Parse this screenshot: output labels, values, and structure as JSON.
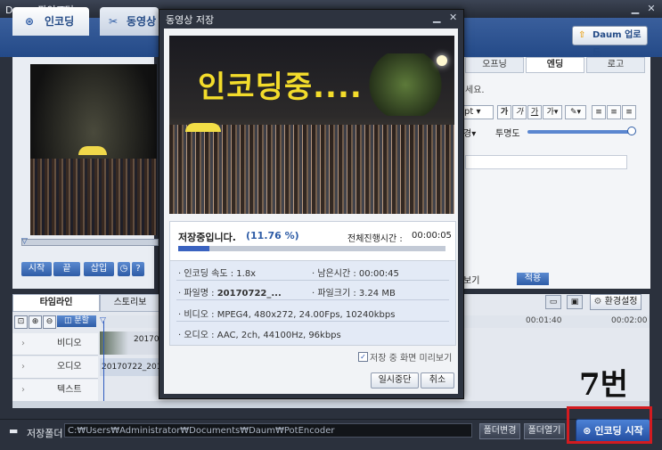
{
  "app": {
    "title": "Daum 팟인코더",
    "tabs": [
      {
        "label": "인코딩"
      },
      {
        "label": "동영상"
      }
    ],
    "upgrade_label": "Daum 업로드"
  },
  "editor": {
    "right_tabs": [
      "오프닝",
      "엔딩",
      "로고"
    ],
    "hint_fragment": "세요.",
    "font_size": "pt",
    "format_buttons": [
      "가",
      "가",
      "가",
      "가"
    ],
    "opacity_label": "투명도",
    "apply_label": "적용",
    "tail_label": "보기",
    "env_label": "환경설정"
  },
  "player": {
    "controls": [
      "시작",
      "끝",
      "삽입",
      "?"
    ]
  },
  "timeline": {
    "tabs": [
      "타임라인",
      "스토리보"
    ],
    "split_label": "분할",
    "ruler": [
      "00:01:40",
      "00:02:00"
    ],
    "tracks": [
      "비디오",
      "오디오",
      "텍스트"
    ],
    "video_clip": "20170",
    "audio_clip": "20170722_201302"
  },
  "bottom": {
    "folder_label": "저장폴더",
    "path": "C:₩Users₩Administrator₩Documents₩Daum₩PotEncoder",
    "change_folder": "폴더변경",
    "open_folder": "폴더열기",
    "start_encoding": "인코딩 시작",
    "annotation": "7번"
  },
  "dialog": {
    "title": "동영상 저장",
    "overlay_text": "인코딩중....",
    "status": "저장중입니다.",
    "percent_label": "(11.76 %)",
    "progress": 0.1176,
    "total_time_label": "전체진행시간 :",
    "total_time": "00:00:05",
    "speed_label": "인코딩 속도 :",
    "speed": "1.8x",
    "remain_label": "남은시간 :",
    "remain": "00:00:45",
    "filename_label": "파일명 :",
    "filename": "20170722_...",
    "filesize_label": "파일크기 :",
    "filesize": "3.24 MB",
    "video_label": "비디오 :",
    "video_info": "MPEG4, 480x272, 24.00Fps, 10240kbps",
    "audio_label": "오디오 :",
    "audio_info": "AAC, 2ch, 44100Hz, 96kbps",
    "preview_checkbox": "저장 중 화면 미리보기",
    "pause_label": "일시중단",
    "cancel_label": "취소"
  },
  "colors": {
    "accent": "#2e5ca6",
    "highlight_box": "#d31b20",
    "overlay_text": "#f3dc2b"
  }
}
